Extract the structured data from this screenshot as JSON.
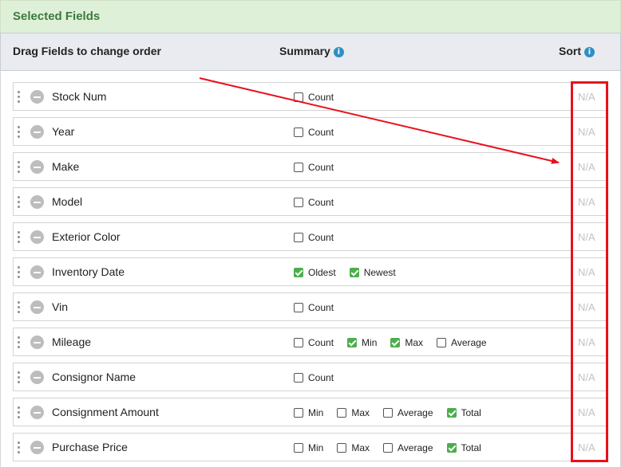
{
  "panel": {
    "title": "Selected Fields"
  },
  "columns": {
    "drag": "Drag Fields to change order",
    "summary": "Summary",
    "sort": "Sort",
    "info_icon": "i"
  },
  "rows": [
    {
      "name": "Stock Num",
      "options": [
        {
          "label": "Count",
          "checked": false
        }
      ],
      "sort": "N/A"
    },
    {
      "name": "Year",
      "options": [
        {
          "label": "Count",
          "checked": false
        }
      ],
      "sort": "N/A"
    },
    {
      "name": "Make",
      "options": [
        {
          "label": "Count",
          "checked": false
        }
      ],
      "sort": "N/A"
    },
    {
      "name": "Model",
      "options": [
        {
          "label": "Count",
          "checked": false
        }
      ],
      "sort": "N/A"
    },
    {
      "name": "Exterior Color",
      "options": [
        {
          "label": "Count",
          "checked": false
        }
      ],
      "sort": "N/A"
    },
    {
      "name": "Inventory Date",
      "options": [
        {
          "label": "Oldest",
          "checked": true
        },
        {
          "label": "Newest",
          "checked": true
        }
      ],
      "sort": "N/A"
    },
    {
      "name": "Vin",
      "options": [
        {
          "label": "Count",
          "checked": false
        }
      ],
      "sort": "N/A"
    },
    {
      "name": "Mileage",
      "options": [
        {
          "label": "Count",
          "checked": false
        },
        {
          "label": "Min",
          "checked": true
        },
        {
          "label": "Max",
          "checked": true
        },
        {
          "label": "Average",
          "checked": false
        }
      ],
      "sort": "N/A"
    },
    {
      "name": "Consignor Name",
      "options": [
        {
          "label": "Count",
          "checked": false
        }
      ],
      "sort": "N/A"
    },
    {
      "name": "Consignment Amount",
      "options": [
        {
          "label": "Min",
          "checked": false
        },
        {
          "label": "Max",
          "checked": false
        },
        {
          "label": "Average",
          "checked": false
        },
        {
          "label": "Total",
          "checked": true
        }
      ],
      "sort": "N/A"
    },
    {
      "name": "Purchase Price",
      "options": [
        {
          "label": "Min",
          "checked": false
        },
        {
          "label": "Max",
          "checked": false
        },
        {
          "label": "Average",
          "checked": false
        },
        {
          "label": "Total",
          "checked": true
        }
      ],
      "sort": "N/A"
    }
  ],
  "icons": {
    "drag": "drag-handle-icon",
    "remove": "remove-circle-icon",
    "info": "info-icon"
  },
  "colors": {
    "header_bg": "#dff0d8",
    "header_text": "#3c7a3c",
    "check_green": "#4cae4c",
    "annotation_red": "#e8111c"
  }
}
